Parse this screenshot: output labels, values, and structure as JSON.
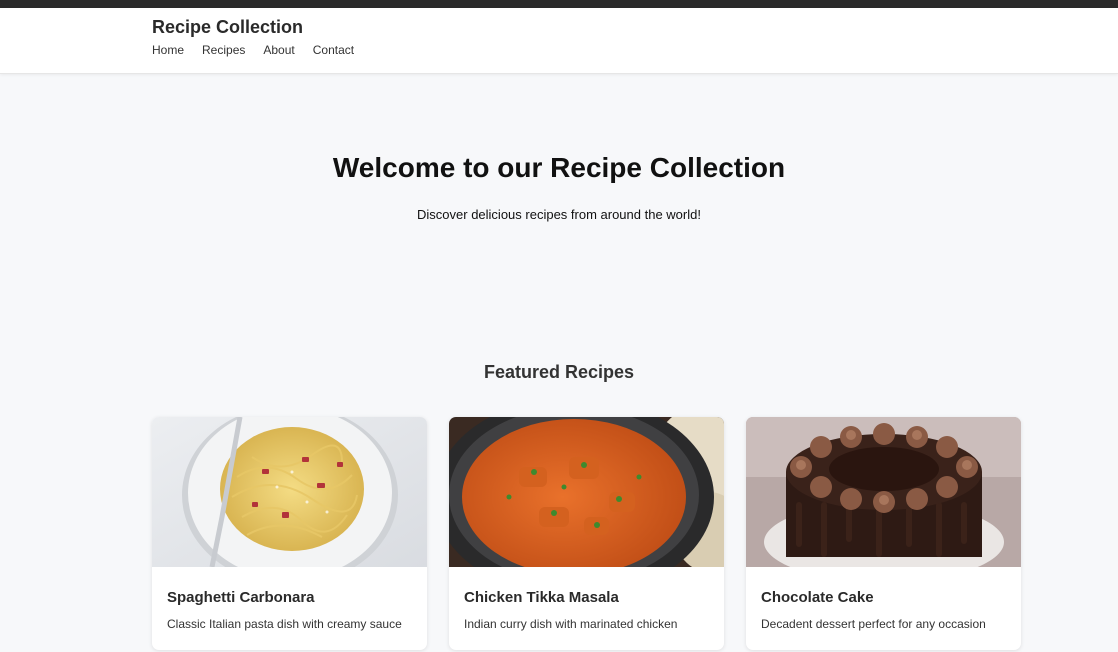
{
  "header": {
    "brand": "Recipe Collection",
    "nav": [
      "Home",
      "Recipes",
      "About",
      "Contact"
    ]
  },
  "hero": {
    "title": "Welcome to our Recipe Collection",
    "subtitle": "Discover delicious recipes from around the world!"
  },
  "featured": {
    "title": "Featured Recipes",
    "recipes": [
      {
        "title": "Spaghetti Carbonara",
        "description": "Classic Italian pasta dish with creamy sauce",
        "image": "spaghetti-carbonara-photo"
      },
      {
        "title": "Chicken Tikka Masala",
        "description": "Indian curry dish with marinated chicken",
        "image": "chicken-tikka-masala-photo"
      },
      {
        "title": "Chocolate Cake",
        "description": "Decadent dessert perfect for any occasion",
        "image": "chocolate-cake-photo"
      }
    ]
  },
  "colors": {
    "topbar": "#2b2b2b",
    "page_background": "#f7f8fa",
    "card_background": "#ffffff"
  }
}
